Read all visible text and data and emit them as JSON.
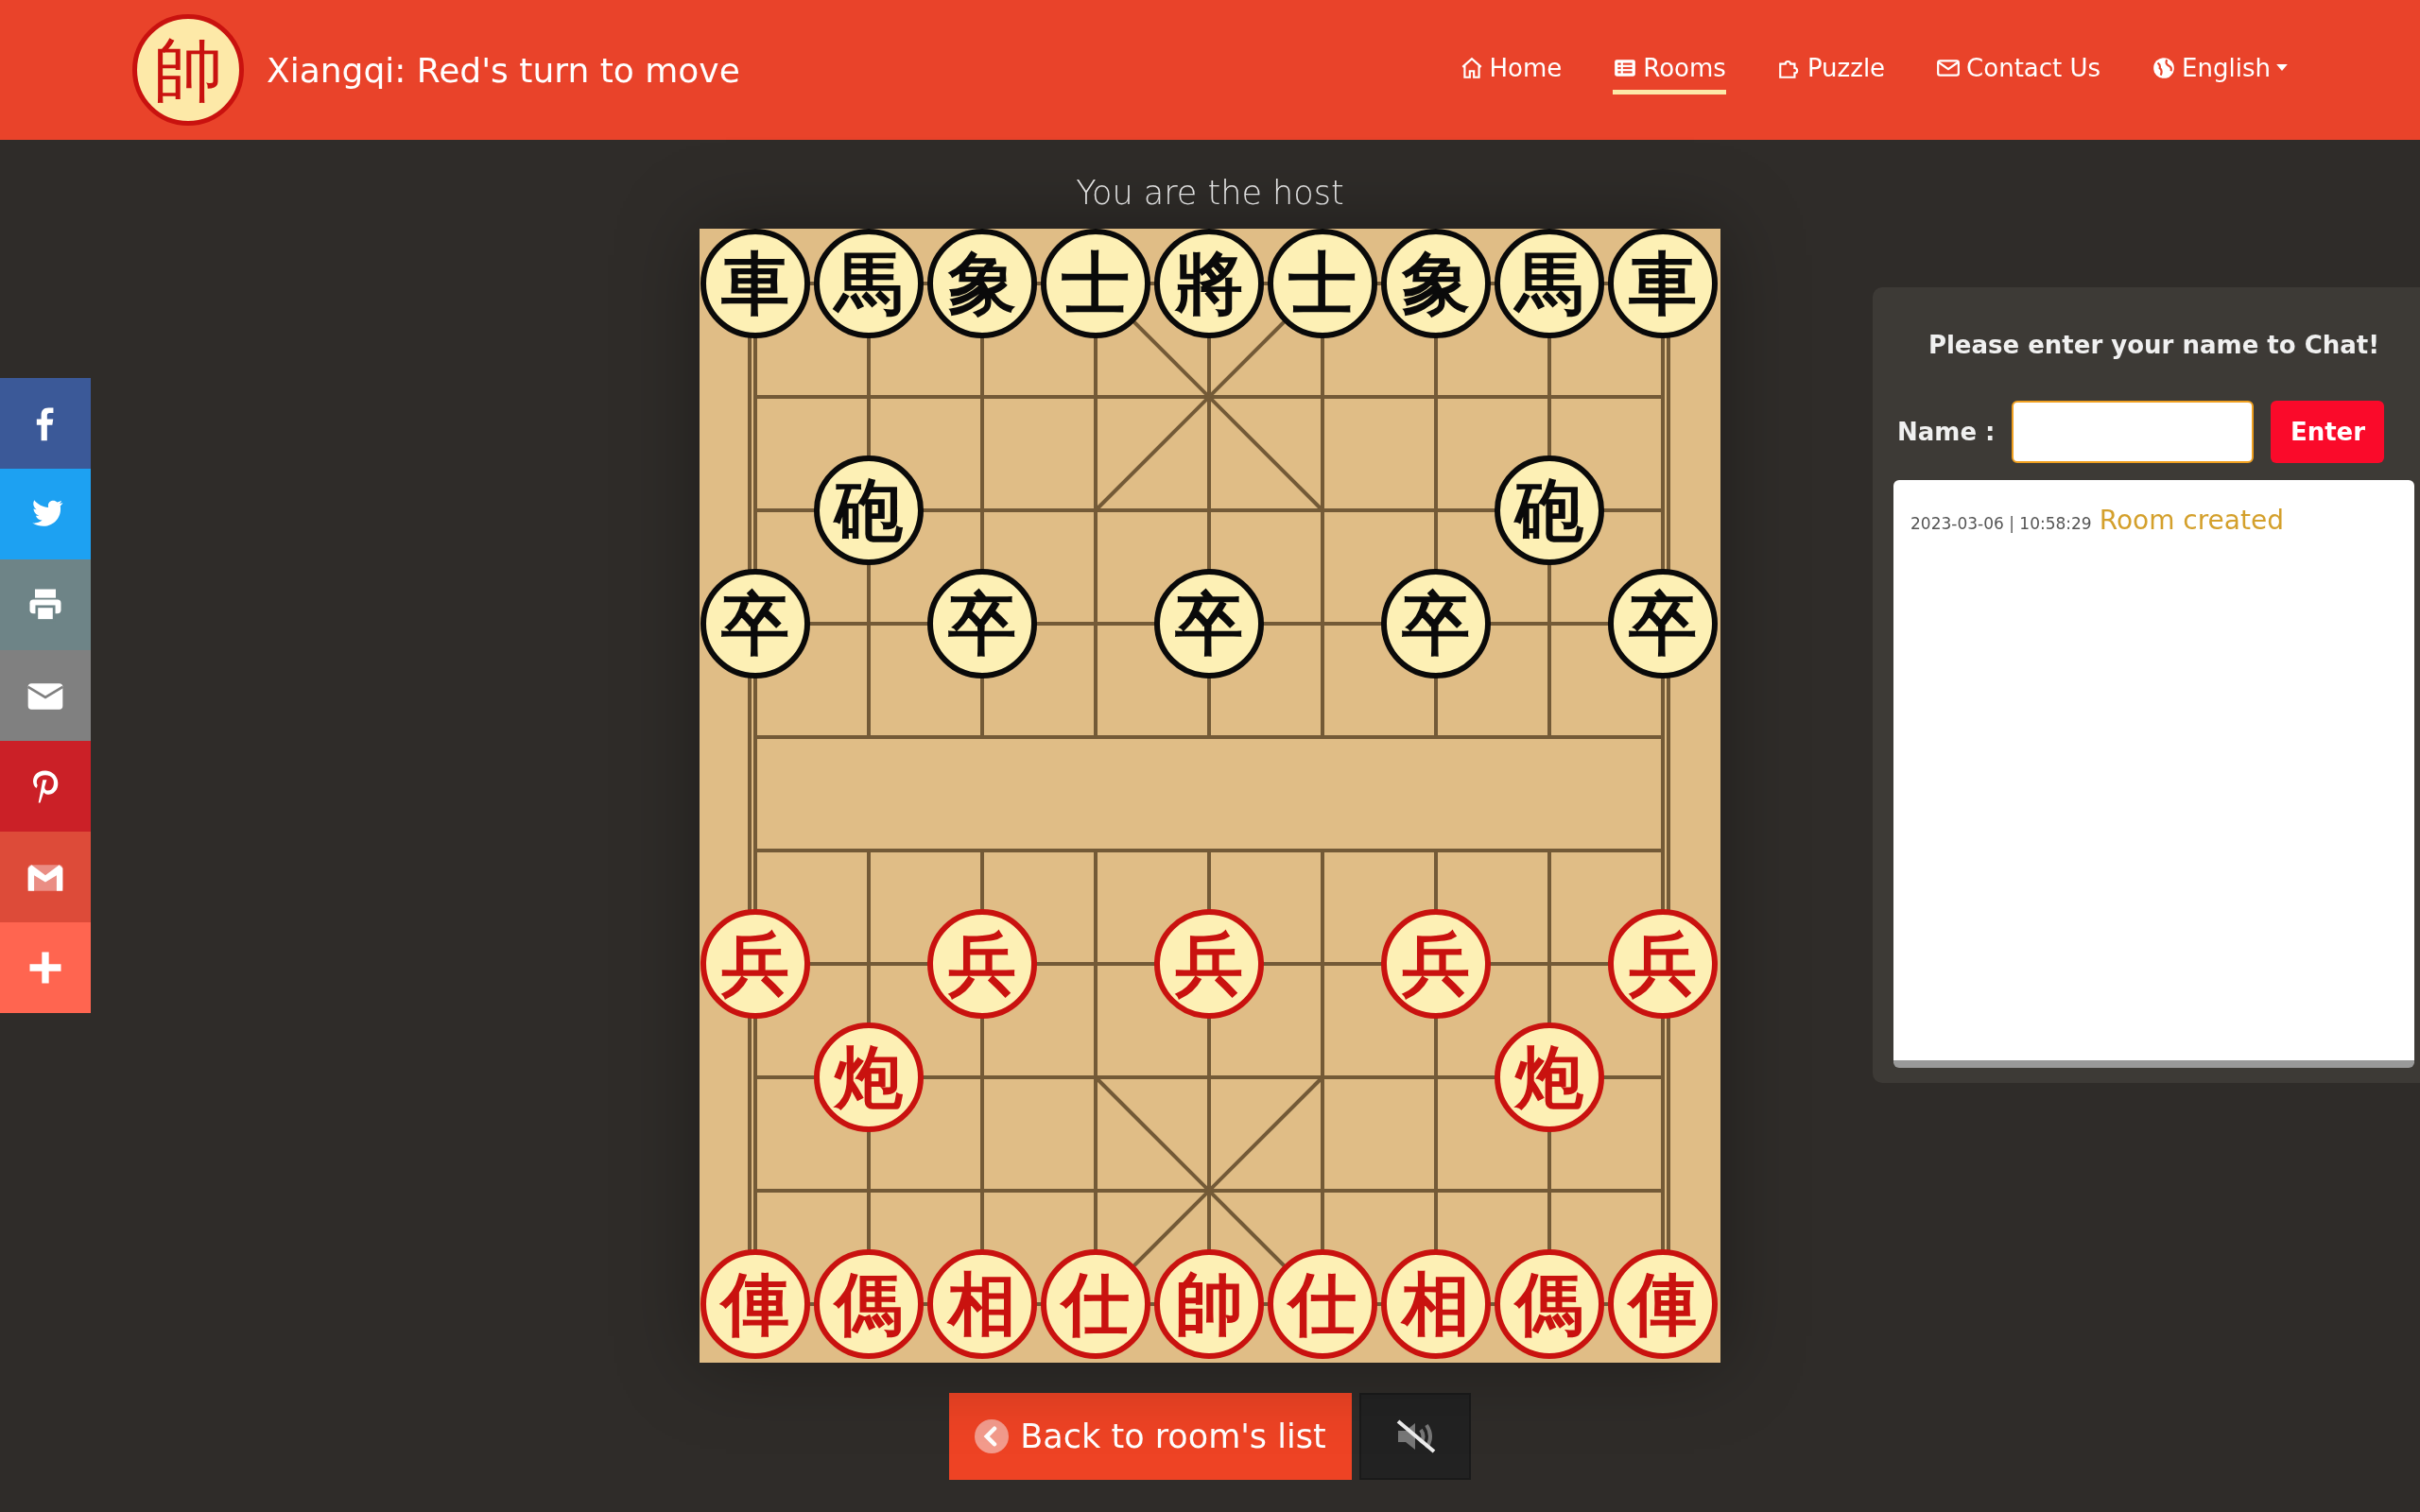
{
  "header": {
    "logo": "帥",
    "title": "Xiangqi: Red's turn to move"
  },
  "nav": [
    {
      "label": "Home",
      "kind": "home",
      "selected": false,
      "dropdown": false
    },
    {
      "label": "Rooms",
      "kind": "list",
      "selected": true,
      "dropdown": false
    },
    {
      "label": "Puzzle",
      "kind": "puzzle",
      "selected": false,
      "dropdown": false
    },
    {
      "label": "Contact Us",
      "kind": "mail",
      "selected": false,
      "dropdown": false
    },
    {
      "label": "English",
      "kind": "globe",
      "selected": false,
      "dropdown": true
    }
  ],
  "share_bar": [
    {
      "kind": "facebook"
    },
    {
      "kind": "twitter"
    },
    {
      "kind": "print"
    },
    {
      "kind": "email"
    },
    {
      "kind": "pinterest"
    },
    {
      "kind": "gmail"
    },
    {
      "kind": "more"
    }
  ],
  "role": "You are the host",
  "board": {
    "ranks": [
      [
        {
          "kind": "piece",
          "char": "車",
          "color": "#0a0a0a"
        },
        {
          "kind": "piece",
          "char": "馬",
          "color": "#0a0a0a"
        },
        {
          "kind": "piece",
          "char": "象",
          "color": "#0a0a0a"
        },
        {
          "kind": "piece",
          "char": "士",
          "color": "#0a0a0a"
        },
        {
          "kind": "piece",
          "char": "將",
          "color": "#0a0a0a"
        },
        {
          "kind": "piece",
          "char": "士",
          "color": "#0a0a0a"
        },
        {
          "kind": "piece",
          "char": "象",
          "color": "#0a0a0a"
        },
        {
          "kind": "piece",
          "char": "馬",
          "color": "#0a0a0a"
        },
        {
          "kind": "piece",
          "char": "車",
          "color": "#0a0a0a"
        }
      ],
      [
        {
          "kind": "empty"
        },
        {
          "kind": "empty"
        },
        {
          "kind": "empty"
        },
        {
          "kind": "empty"
        },
        {
          "kind": "empty"
        },
        {
          "kind": "empty"
        },
        {
          "kind": "empty"
        },
        {
          "kind": "empty"
        },
        {
          "kind": "empty"
        }
      ],
      [
        {
          "kind": "empty"
        },
        {
          "kind": "piece",
          "char": "砲",
          "color": "#0a0a0a"
        },
        {
          "kind": "empty"
        },
        {
          "kind": "empty"
        },
        {
          "kind": "empty"
        },
        {
          "kind": "empty"
        },
        {
          "kind": "empty"
        },
        {
          "kind": "piece",
          "char": "砲",
          "color": "#0a0a0a"
        },
        {
          "kind": "empty"
        }
      ],
      [
        {
          "kind": "piece",
          "char": "卒",
          "color": "#0a0a0a"
        },
        {
          "kind": "empty"
        },
        {
          "kind": "piece",
          "char": "卒",
          "color": "#0a0a0a"
        },
        {
          "kind": "empty"
        },
        {
          "kind": "piece",
          "char": "卒",
          "color": "#0a0a0a"
        },
        {
          "kind": "empty"
        },
        {
          "kind": "piece",
          "char": "卒",
          "color": "#0a0a0a"
        },
        {
          "kind": "empty"
        },
        {
          "kind": "piece",
          "char": "卒",
          "color": "#0a0a0a"
        }
      ],
      [
        {
          "kind": "empty"
        },
        {
          "kind": "empty"
        },
        {
          "kind": "empty"
        },
        {
          "kind": "empty"
        },
        {
          "kind": "empty"
        },
        {
          "kind": "empty"
        },
        {
          "kind": "empty"
        },
        {
          "kind": "empty"
        },
        {
          "kind": "empty"
        }
      ],
      [
        {
          "kind": "empty"
        },
        {
          "kind": "empty"
        },
        {
          "kind": "empty"
        },
        {
          "kind": "empty"
        },
        {
          "kind": "empty"
        },
        {
          "kind": "empty"
        },
        {
          "kind": "empty"
        },
        {
          "kind": "empty"
        },
        {
          "kind": "empty"
        }
      ],
      [
        {
          "kind": "piece",
          "char": "兵",
          "color": "#c9120f"
        },
        {
          "kind": "empty"
        },
        {
          "kind": "piece",
          "char": "兵",
          "color": "#c9120f"
        },
        {
          "kind": "empty"
        },
        {
          "kind": "piece",
          "char": "兵",
          "color": "#c9120f"
        },
        {
          "kind": "empty"
        },
        {
          "kind": "piece",
          "char": "兵",
          "color": "#c9120f"
        },
        {
          "kind": "empty"
        },
        {
          "kind": "piece",
          "char": "兵",
          "color": "#c9120f"
        }
      ],
      [
        {
          "kind": "empty"
        },
        {
          "kind": "piece",
          "char": "炮",
          "color": "#c9120f"
        },
        {
          "kind": "empty"
        },
        {
          "kind": "empty"
        },
        {
          "kind": "empty"
        },
        {
          "kind": "empty"
        },
        {
          "kind": "empty"
        },
        {
          "kind": "piece",
          "char": "炮",
          "color": "#c9120f"
        },
        {
          "kind": "empty"
        }
      ],
      [
        {
          "kind": "empty"
        },
        {
          "kind": "empty"
        },
        {
          "kind": "empty"
        },
        {
          "kind": "empty"
        },
        {
          "kind": "empty"
        },
        {
          "kind": "empty"
        },
        {
          "kind": "empty"
        },
        {
          "kind": "empty"
        },
        {
          "kind": "empty"
        }
      ],
      [
        {
          "kind": "piece",
          "char": "俥",
          "color": "#c9120f"
        },
        {
          "kind": "piece",
          "char": "傌",
          "color": "#c9120f"
        },
        {
          "kind": "piece",
          "char": "相",
          "color": "#c9120f"
        },
        {
          "kind": "piece",
          "char": "仕",
          "color": "#c9120f"
        },
        {
          "kind": "piece",
          "char": "帥",
          "color": "#c9120f"
        },
        {
          "kind": "piece",
          "char": "仕",
          "color": "#c9120f"
        },
        {
          "kind": "piece",
          "char": "相",
          "color": "#c9120f"
        },
        {
          "kind": "piece",
          "char": "傌",
          "color": "#c9120f"
        },
        {
          "kind": "piece",
          "char": "俥",
          "color": "#c9120f"
        }
      ]
    ]
  },
  "back_button": "Back to room's list",
  "sound": {
    "muted": true
  },
  "chat": {
    "prompt": "Please enter your name to Chat!",
    "name_label": "Name :",
    "name_field": {
      "focused": true
    },
    "enter_button": "Enter",
    "messages": [
      {
        "time": "2023-03-06 | 10:58:29",
        "text": "Room created"
      }
    ]
  }
}
